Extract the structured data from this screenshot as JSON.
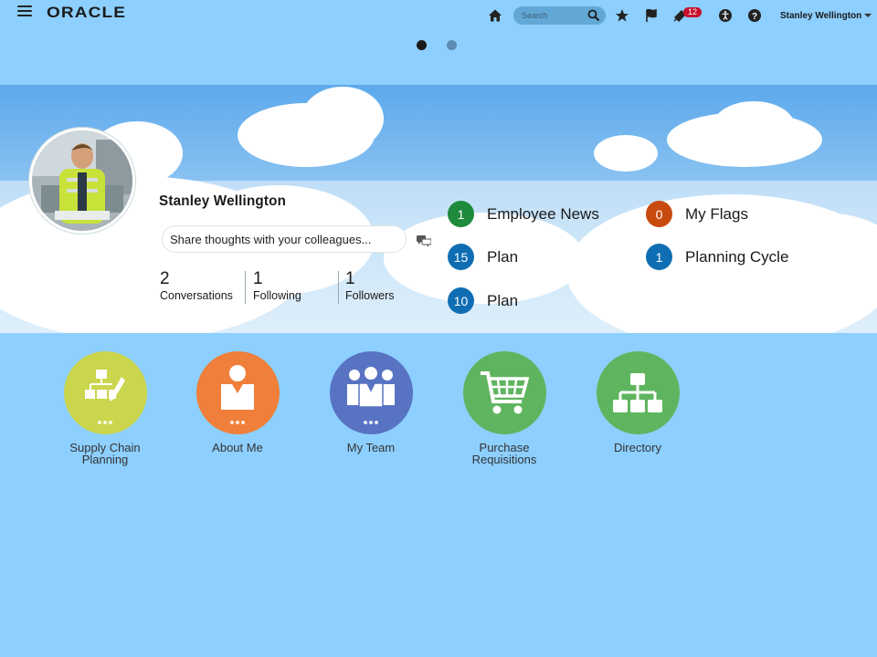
{
  "header": {
    "logo_text": "ORACLE",
    "search_placeholder": "Search",
    "notifications_count": "12",
    "user_name": "Stanley Wellington"
  },
  "carousel": {
    "pages": 2,
    "active_index": 0
  },
  "profile": {
    "name": "Stanley Wellington",
    "share_placeholder": "Share thoughts with your colleagues...",
    "stats": [
      {
        "value": "2",
        "label": "Conversations"
      },
      {
        "value": "1",
        "label": "Following"
      },
      {
        "value": "1",
        "label": "Followers"
      }
    ]
  },
  "badges": [
    {
      "count": "1",
      "label": "Employee News",
      "color": "#1e8a3c"
    },
    {
      "count": "15",
      "label": "Plan",
      "color": "#0f6eb3"
    },
    {
      "count": "10",
      "label": "Plan",
      "color": "#0f6eb3"
    },
    {
      "count": "0",
      "label": "My Flags",
      "color": "#c74a0f"
    },
    {
      "count": "1",
      "label": "Planning Cycle",
      "color": "#0f6eb3"
    }
  ],
  "springboard": [
    {
      "label": "Supply Chain Planning",
      "icon": "supply-chain-icon",
      "color": "#cbd64e"
    },
    {
      "label": "About Me",
      "icon": "person-icon",
      "color": "#ef7f3a"
    },
    {
      "label": "My Team",
      "icon": "team-icon",
      "color": "#5873c2"
    },
    {
      "label": "Purchase Requisitions",
      "icon": "shopping-cart-icon",
      "color": "#5fb55f"
    },
    {
      "label": "Directory",
      "icon": "org-chart-icon",
      "color": "#5fb55f"
    }
  ]
}
